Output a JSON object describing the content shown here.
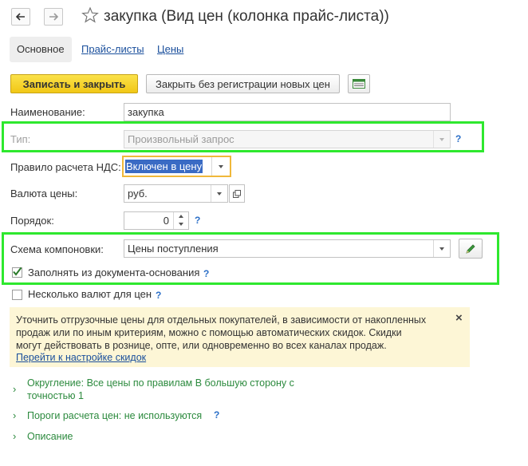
{
  "header": {
    "title": "закупка (Вид цен (колонка прайс-листа))"
  },
  "tabs": [
    {
      "label": "Основное"
    },
    {
      "label": "Прайс-листы"
    },
    {
      "label": "Цены"
    }
  ],
  "toolbar": {
    "save_close": "Записать и закрыть",
    "close_no_reg": "Закрыть без регистрации новых цен"
  },
  "form": {
    "name_label": "Наименование:",
    "name_value": "закупка",
    "type_label": "Тип:",
    "type_value": "Произвольный запрос",
    "vat_label": "Правило расчета НДС:",
    "vat_value": "Включен в цену",
    "currency_label": "Валюта цены:",
    "currency_value": "руб.",
    "order_label": "Порядок:",
    "order_value": "0",
    "scheme_label": "Схема компоновки:",
    "scheme_value": "Цены поступления",
    "fill_from_doc_label": "Заполнять из документа-основания",
    "fill_from_doc_checked": true,
    "multi_currency_label": "Несколько валют для цен",
    "multi_currency_checked": false,
    "help_mark": "?"
  },
  "note": {
    "line1": "Уточнить отгрузочные цены для отдельных покупателей, в зависимости от накопленных",
    "line2": "продаж или по иным критериям, можно с помощью автоматических скидок. Скидки",
    "line3": "могут действовать в рознице, опте, или одновременно во всех каналах продаж.",
    "link": "Перейти к настройке скидок",
    "close": "×"
  },
  "sections": [
    {
      "line1": "Округление: Все цены по правилам В большую сторону с",
      "line2": "точностью 1"
    },
    {
      "line1": "Пороги расчета цен: не используются"
    },
    {
      "line1": "Описание"
    }
  ],
  "colors": {
    "highlight": "#2ee82e",
    "primary_button": "#f5d22a",
    "link": "#1a4f9c",
    "group_link": "#2c8a3e",
    "note_bg": "#fdf6d6",
    "selection": "#3a6bc4"
  }
}
